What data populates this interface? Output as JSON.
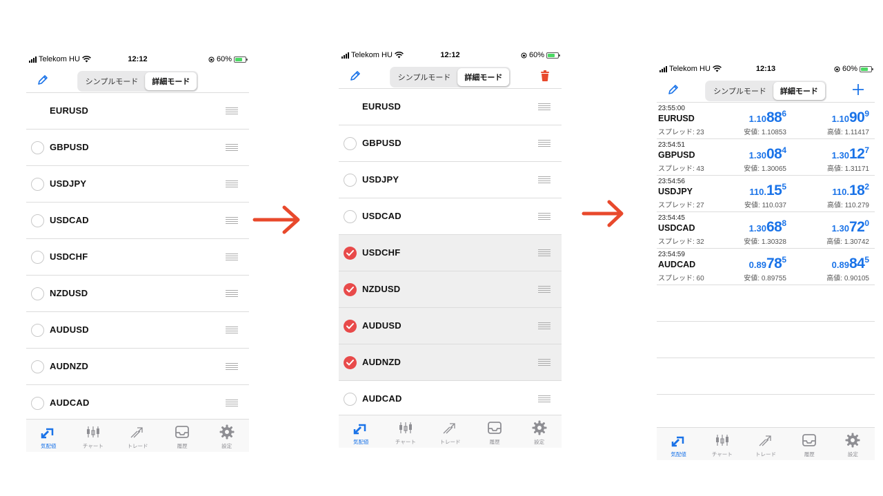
{
  "status": {
    "carrier": "Telekom HU",
    "battery": "60%",
    "time1": "12:12",
    "time2": "12:12",
    "time3": "12:13"
  },
  "modes": {
    "simple": "シンプルモード",
    "detail": "詳細モード"
  },
  "phone1": {
    "rows": [
      {
        "symbol": "EURUSD",
        "has_radio": false
      },
      {
        "symbol": "GBPUSD",
        "has_radio": true
      },
      {
        "symbol": "USDJPY",
        "has_radio": true
      },
      {
        "symbol": "USDCAD",
        "has_radio": true
      },
      {
        "symbol": "USDCHF",
        "has_radio": true
      },
      {
        "symbol": "NZDUSD",
        "has_radio": true
      },
      {
        "symbol": "AUDUSD",
        "has_radio": true
      },
      {
        "symbol": "AUDNZD",
        "has_radio": true
      },
      {
        "symbol": "AUDCAD",
        "has_radio": true
      }
    ]
  },
  "phone2": {
    "rows": [
      {
        "symbol": "EURUSD",
        "has_radio": false,
        "checked": false
      },
      {
        "symbol": "GBPUSD",
        "has_radio": true,
        "checked": false
      },
      {
        "symbol": "USDJPY",
        "has_radio": true,
        "checked": false
      },
      {
        "symbol": "USDCAD",
        "has_radio": true,
        "checked": false
      },
      {
        "symbol": "USDCHF",
        "has_radio": true,
        "checked": true
      },
      {
        "symbol": "NZDUSD",
        "has_radio": true,
        "checked": true
      },
      {
        "symbol": "AUDUSD",
        "has_radio": true,
        "checked": true
      },
      {
        "symbol": "AUDNZD",
        "has_radio": true,
        "checked": true
      },
      {
        "symbol": "AUDCAD",
        "has_radio": true,
        "checked": false
      }
    ]
  },
  "phone3": {
    "quotes": [
      {
        "time": "23:55:00",
        "symbol": "EURUSD",
        "spread": "スプレッド: 23",
        "bid": [
          "1.10",
          "88",
          "6"
        ],
        "ask": [
          "1.10",
          "90",
          "9"
        ],
        "low": "安値: 1.10853",
        "high": "高値: 1.11417"
      },
      {
        "time": "23:54:51",
        "symbol": "GBPUSD",
        "spread": "スプレッド: 43",
        "bid": [
          "1.30",
          "08",
          "4"
        ],
        "ask": [
          "1.30",
          "12",
          "7"
        ],
        "low": "安値: 1.30065",
        "high": "高値: 1.31171"
      },
      {
        "time": "23:54:56",
        "symbol": "USDJPY",
        "spread": "スプレッド: 27",
        "bid": [
          "110.",
          "15",
          "5"
        ],
        "ask": [
          "110.",
          "18",
          "2"
        ],
        "low": "安値: 110.037",
        "high": "高値: 110.279"
      },
      {
        "time": "23:54:45",
        "symbol": "USDCAD",
        "spread": "スプレッド: 32",
        "bid": [
          "1.30",
          "68",
          "8"
        ],
        "ask": [
          "1.30",
          "72",
          "0"
        ],
        "low": "安値: 1.30328",
        "high": "高値: 1.30742"
      },
      {
        "time": "23:54:59",
        "symbol": "AUDCAD",
        "spread": "スプレッド: 60",
        "bid": [
          "0.89",
          "78",
          "5"
        ],
        "ask": [
          "0.89",
          "84",
          "5"
        ],
        "low": "安値: 0.89755",
        "high": "高値: 0.90105"
      }
    ],
    "empty_rows": 4
  },
  "tabs": [
    {
      "label": "気配値",
      "icon": "quotes-icon",
      "active": true
    },
    {
      "label": "チャート",
      "icon": "chart-icon",
      "active": false
    },
    {
      "label": "トレード",
      "icon": "trade-icon",
      "active": false
    },
    {
      "label": "履歴",
      "icon": "history-icon",
      "active": false
    },
    {
      "label": "設定",
      "icon": "settings-icon",
      "active": false
    }
  ],
  "colors": {
    "accent": "#1a73e8",
    "arrow": "#e8492c",
    "check": "#e84a4a",
    "delete": "#e8492c"
  }
}
